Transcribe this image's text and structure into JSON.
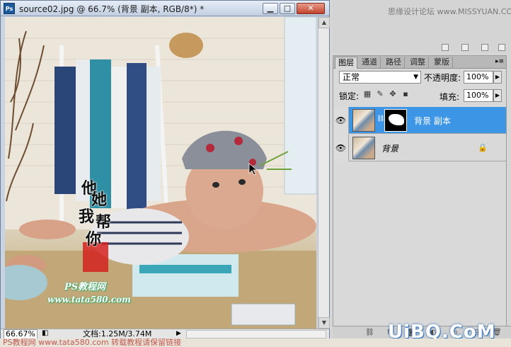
{
  "document": {
    "title": "source02.jpg @ 66.7% (背景 副本, RGB/8*) *",
    "zoom": "66.67%",
    "doc_info": "文档:1.25M/3.74M",
    "watermark_lines": [
      "他",
      "她",
      "我",
      "帮",
      "你"
    ],
    "watermark_ps": "PS教程网",
    "watermark_site": "www.tata580.com"
  },
  "top_panel": {
    "site_text": "思缘设计论坛 www.MISSYUAN.COM"
  },
  "layers_panel": {
    "tabs": [
      {
        "label": "图层",
        "active": true
      },
      {
        "label": "通道",
        "active": false
      },
      {
        "label": "路径",
        "active": false
      },
      {
        "label": "调整",
        "active": false
      },
      {
        "label": "蒙版",
        "active": false
      }
    ],
    "blend_mode": "正常",
    "opacity_label": "不透明度:",
    "opacity_value": "100%",
    "lock_label": "锁定:",
    "fill_label": "填充:",
    "fill_value": "100%",
    "layers": [
      {
        "name": "背景 副本",
        "selected": true,
        "has_mask": true
      },
      {
        "name": "背景",
        "selected": false,
        "has_mask": false,
        "locked": true
      }
    ]
  },
  "brand": {
    "logo_text": "UiBQ.CoM"
  },
  "bottom_watermark": "PS教程网 www.tata580.com 转载教程请保留链接",
  "colors": {
    "selection": "#3d95e6",
    "title_close": "#c0432c"
  }
}
